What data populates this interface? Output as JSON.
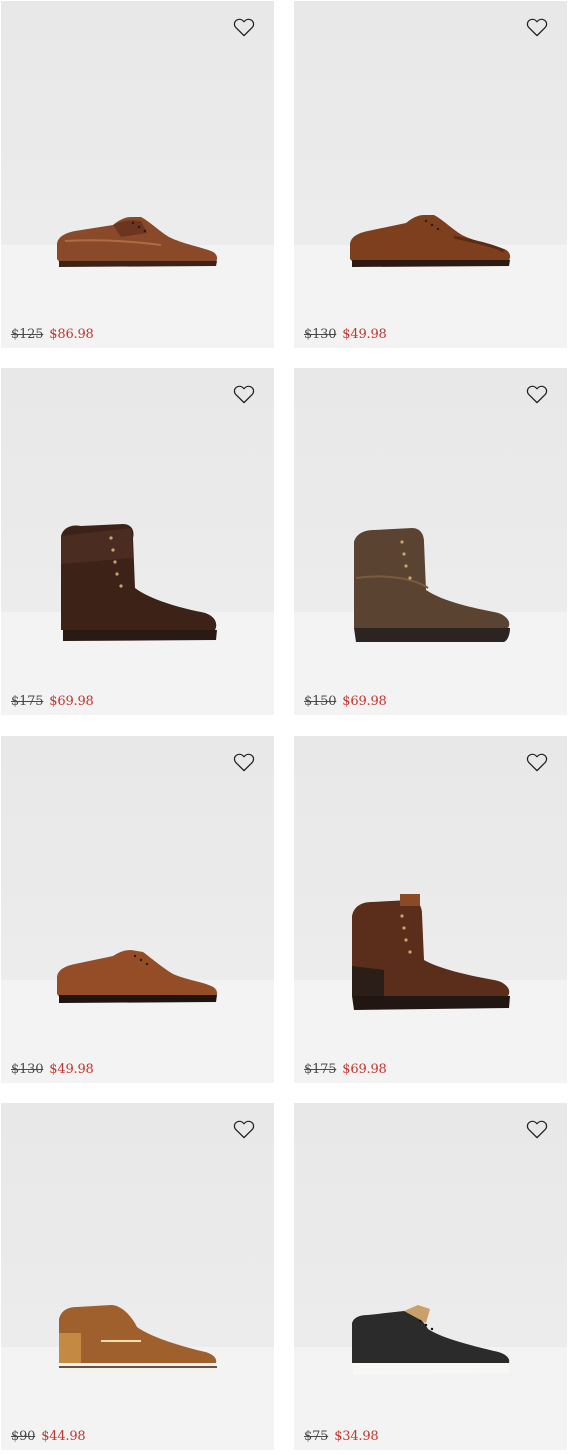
{
  "products": [
    {
      "id": "p1",
      "shoe": "brown-derby-shoe",
      "old_price": "$125",
      "sale_price": "$86.98"
    },
    {
      "id": "p2",
      "shoe": "brown-wingtip-shoe",
      "old_price": "$130",
      "sale_price": "$49.98"
    },
    {
      "id": "p3",
      "shoe": "dark-brown-lace-up-boot",
      "old_price": "$175",
      "sale_price": "$69.98"
    },
    {
      "id": "p4",
      "shoe": "olive-brown-work-boot",
      "old_price": "$150",
      "sale_price": "$69.98"
    },
    {
      "id": "p5",
      "shoe": "cognac-oxford-shoe",
      "old_price": "$130",
      "sale_price": "$49.98"
    },
    {
      "id": "p6",
      "shoe": "brown-cap-toe-boot",
      "old_price": "$175",
      "sale_price": "$69.98"
    },
    {
      "id": "p7",
      "shoe": "tan-high-top-sneaker",
      "old_price": "$90",
      "sale_price": "$44.98"
    },
    {
      "id": "p8",
      "shoe": "black-low-top-sneaker",
      "old_price": "$75",
      "sale_price": "$34.98"
    }
  ],
  "icons": {
    "wishlist": "heart-outline-icon"
  },
  "colors": {
    "sale_price": "#c2352e",
    "old_price": "#4a4a4a",
    "card_background": "#ebebeb"
  }
}
